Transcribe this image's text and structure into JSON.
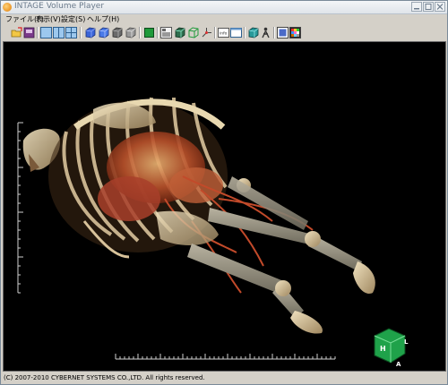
{
  "window": {
    "title": "INTAGE Volume Player"
  },
  "menubar": {
    "items": [
      "ファイル(F)",
      "表示(V)",
      "設定(S)",
      "ヘルプ(H)"
    ]
  },
  "toolbar": {
    "buttons": [
      {
        "name": "open-folder-icon"
      },
      {
        "name": "save-image-icon"
      },
      {
        "name": "layout-single-icon"
      },
      {
        "name": "layout-two-pane-icon"
      },
      {
        "name": "layout-four-pane-icon"
      },
      {
        "name": "volume-cube-blue-icon"
      },
      {
        "name": "volume-cube-blue-alt-icon"
      },
      {
        "name": "volume-cube-gray-icon"
      },
      {
        "name": "volume-cube-gray-alt-icon"
      },
      {
        "name": "green-square-icon"
      },
      {
        "name": "mpr-view-icon"
      },
      {
        "name": "cube-wireframe-icon"
      },
      {
        "name": "cube-outline-green-icon"
      },
      {
        "name": "axis-arrows-icon"
      },
      {
        "name": "info-panel-icon"
      },
      {
        "name": "blank-panel-icon"
      },
      {
        "name": "teal-cube-icon"
      },
      {
        "name": "anatomy-figure-icon"
      },
      {
        "name": "window-preset-icon"
      },
      {
        "name": "color-palette-icon"
      }
    ]
  },
  "viewport": {
    "orientation_cube": {
      "labels": [
        "H",
        "L",
        "A"
      ],
      "color": "#1fa24a"
    }
  },
  "status": {
    "text": "(C) 2007-2010 CYBERNET SYSTEMS CO.,LTD. All rights reserved."
  },
  "colors": {
    "bone": "#d8c4a0",
    "vessel": "#b8432a",
    "background": "#000000",
    "chrome": "#d4d0c8"
  }
}
